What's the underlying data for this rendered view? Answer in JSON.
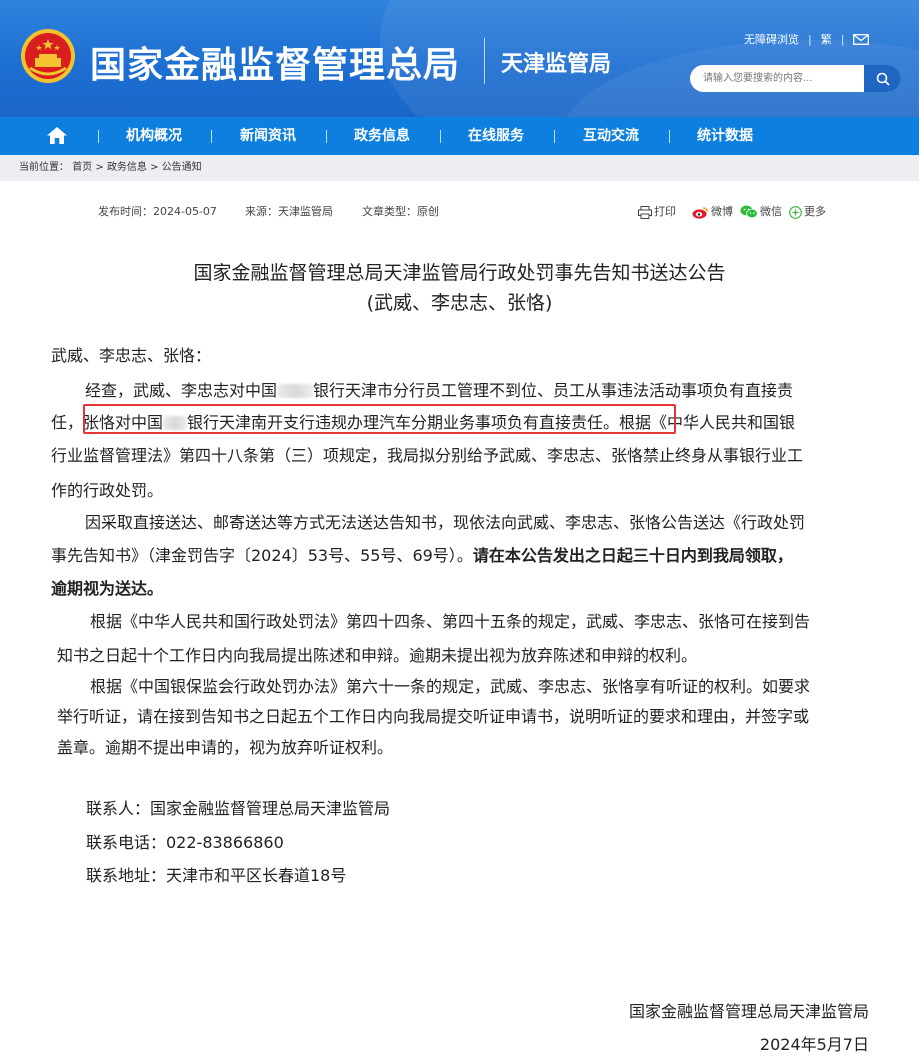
{
  "header": {
    "site_title": "国家金融监督管理总局",
    "sub_title": "天津监管局",
    "top_links": {
      "accessible": "无障碍浏览",
      "lang": "繁",
      "mail_icon": "mail-icon"
    },
    "search": {
      "placeholder": "请输入您要搜索的内容..."
    }
  },
  "nav": {
    "home_icon": "home-icon",
    "items": [
      "机构概况",
      "新闻资讯",
      "政务信息",
      "在线服务",
      "互动交流",
      "统计数据"
    ]
  },
  "breadcrumb": {
    "prefix": "当前位置：",
    "home": "首页",
    "sep": " > ",
    "section": "政务信息",
    "page": "公告通知"
  },
  "meta": {
    "date": "发布时间：2024-05-07",
    "source": "来源：天津监管局",
    "type": "文章类型：原创"
  },
  "share": {
    "print": "打印",
    "weibo": "微博",
    "wechat": "微信",
    "more": "更多"
  },
  "article": {
    "title_line1": "国家金融监督管理总局天津监管局行政处罚事先告知书送达公告",
    "title_line2": "(武威、李忠志、张恪)",
    "salutation": "武威、李忠志、张恪：",
    "p1_l1_a": "经查，武威、李忠志对中国",
    "p1_l1_b": "银行天津市分行员工管理不到位、员工从事违法活动事项负有直接责",
    "p1_l2_a": "任，",
    "p1_l2_b": "张恪对中国",
    "p1_l2_c": "银行天津南开支行违规办理汽车分期业务事项负有直接责任。",
    "p1_l2_d": "根据《中华人民共和国银",
    "p1_l3": "行业监督管理法》第四十八条第（三）项规定，我局拟分别给予武威、李忠志、张恪禁止终身从事银行业工",
    "p1_l4": "作的行政处罚。",
    "p2_l1": "因采取直接送达、邮寄送达等方式无法送达告知书，现依法向武威、李忠志、张恪公告送达《行政处罚",
    "p2_l2_a": "事先告知书》（津金罚告字〔2024〕53号、55号、69号）。",
    "p2_l2_b": "请在本公告发出之日起三十日内到我局领取，",
    "p2_l3": "逾期视为送达。",
    "p3_l1": "根据《中华人民共和国行政处罚法》第四十四条、第四十五条的规定，武威、李忠志、张恪可在接到告",
    "p3_l2": "知书之日起十个工作日内向我局提出陈述和申辩。逾期未提出视为放弃陈述和申辩的权利。",
    "p4_l1": "根据《中国银保监会行政处罚办法》第六十一条的规定，武威、李忠志、张恪享有听证的权利。如要求",
    "p4_l2": "举行听证，请在接到告知书之日起五个工作日内向我局提交听证申请书，说明听证的要求和理由，并签字或",
    "p4_l3": "盖章。逾期不提出申请的，视为放弃听证权利。",
    "contact_person": "联系人：国家金融监督管理总局天津监管局",
    "contact_phone": "联系电话：022-83866860",
    "contact_address": "联系地址：天津市和平区长春道18号",
    "sign_org": "国家金融监督管理总局天津监管局",
    "sign_date": "2024年5月7日"
  },
  "colors": {
    "header_blue": "#1d6fd2",
    "nav_blue": "#0d7fdf",
    "highlight_red": "#e23535"
  }
}
